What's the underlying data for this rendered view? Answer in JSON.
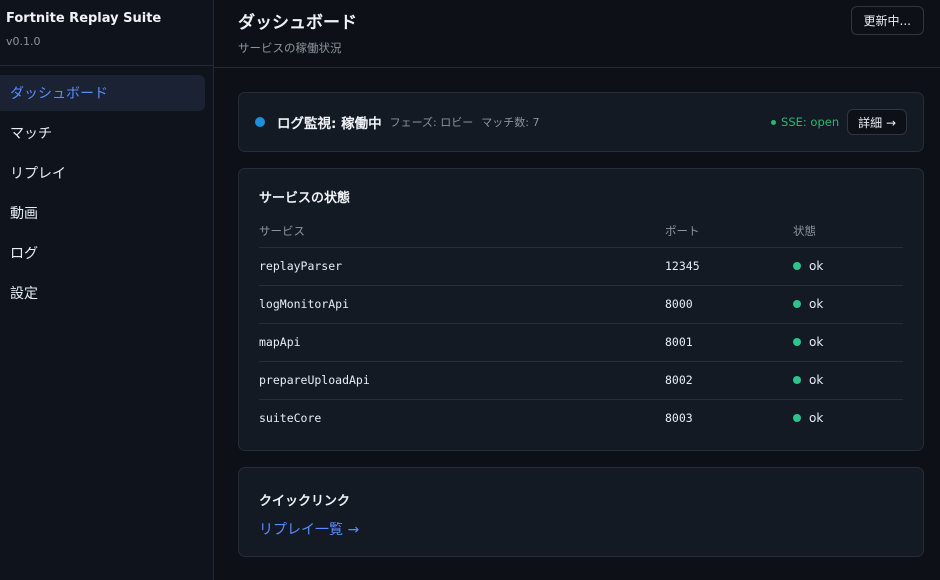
{
  "app": {
    "title": "Fortnite Replay Suite",
    "version": "v0.1.0"
  },
  "nav": {
    "items": [
      {
        "label": "ダッシュボード",
        "active": true
      },
      {
        "label": "マッチ"
      },
      {
        "label": "リプレイ"
      },
      {
        "label": "動画"
      },
      {
        "label": "ログ"
      },
      {
        "label": "設定"
      }
    ]
  },
  "header": {
    "title": "ダッシュボード",
    "subtitle": "サービスの稼働状況",
    "refresh_label": "更新中..."
  },
  "monitor": {
    "title": "ログ監視: 稼働中",
    "phase": "フェーズ: ロビー",
    "match_count": "マッチ数: 7",
    "sse": "SSE: open",
    "detail_label": "詳細 →",
    "status_color": "#1f8fdb"
  },
  "services": {
    "title": "サービスの状態",
    "columns": [
      "サービス",
      "ポート",
      "状態"
    ],
    "rows": [
      {
        "name": "replayParser",
        "port": "12345",
        "status": "ok"
      },
      {
        "name": "logMonitorApi",
        "port": "8000",
        "status": "ok"
      },
      {
        "name": "mapApi",
        "port": "8001",
        "status": "ok"
      },
      {
        "name": "prepareUploadApi",
        "port": "8002",
        "status": "ok"
      },
      {
        "name": "suiteCore",
        "port": "8003",
        "status": "ok"
      }
    ],
    "ok_color": "#2bc48a"
  },
  "quick_links": {
    "title": "クイックリンク",
    "replay_link": "リプレイ一覧 →"
  },
  "colors": {
    "accent": "#5b8cff",
    "sse": "#2bb673"
  }
}
